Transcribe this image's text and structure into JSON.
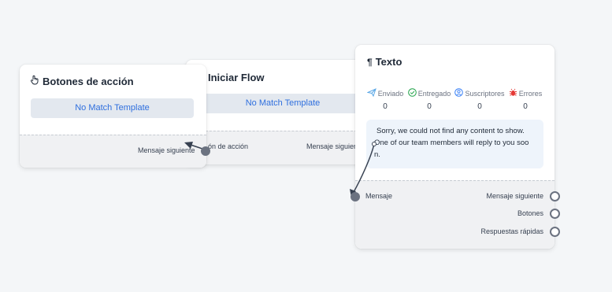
{
  "nodes": {
    "iniciar_flow": {
      "title": "Iniciar Flow",
      "template_label": "No Match Template",
      "input_label": "ón de acción",
      "output_label": "Mensaje siguien"
    },
    "botones_accion": {
      "title": "Botones de acción",
      "template_label": "No Match Template",
      "output_label": "Mensaje siguiente"
    },
    "texto": {
      "title": "Texto",
      "stats": [
        {
          "label": "Enviado",
          "value": "0",
          "icon": "send-icon",
          "color": "#5aa7e6"
        },
        {
          "label": "Entregado",
          "value": "0",
          "icon": "check-circle-icon",
          "color": "#22a34a"
        },
        {
          "label": "Suscriptores",
          "value": "0",
          "icon": "user-circle-icon",
          "color": "#3b82f6"
        },
        {
          "label": "Errores",
          "value": "0",
          "icon": "bug-icon",
          "color": "#e53935"
        }
      ],
      "message_lines": [
        "Sorry, we could not find any content to show.",
        "One of our team members will reply to you soo",
        "n."
      ],
      "input_label": "Mensaje",
      "outputs": [
        "Mensaje siguiente",
        "Botones",
        "Respuestas rápidas"
      ]
    }
  },
  "colors": {
    "accent": "#2f6fde",
    "wire": "#374151",
    "port": "#6b7280"
  }
}
